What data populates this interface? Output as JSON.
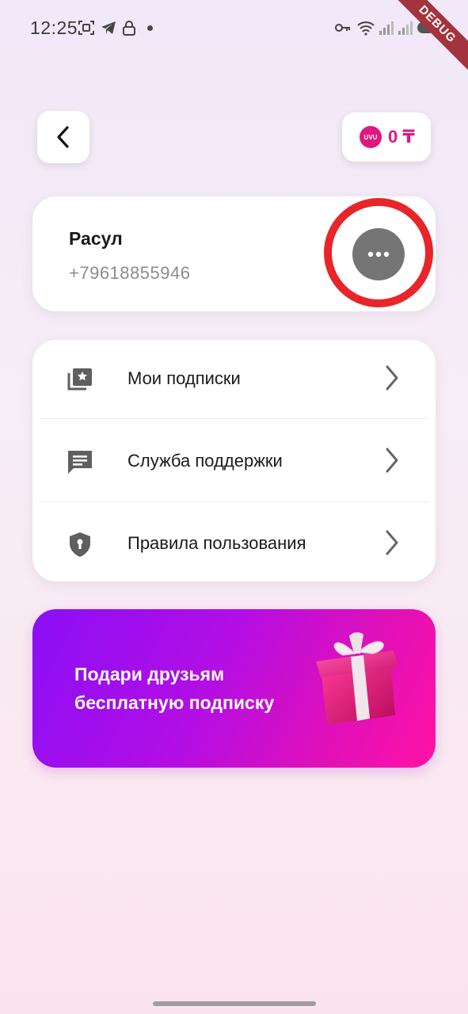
{
  "status_bar": {
    "time": "12:25",
    "debug_label": "DEBUG",
    "icons": [
      "screenshot-icon",
      "telegram-icon",
      "lock-icon",
      "key-icon",
      "wifi-icon",
      "signal-icon",
      "signal-icon",
      "battery-icon"
    ]
  },
  "header": {
    "back_icon": "chevron-left-icon",
    "balance": {
      "coin_label": "UVU",
      "value": "0 ₸"
    }
  },
  "profile": {
    "name": "Расул",
    "phone": "+79618855946",
    "more_icon": "more-horizontal-icon"
  },
  "menu": {
    "items": [
      {
        "label": "Мои подписки",
        "icon": "subscriptions-icon"
      },
      {
        "label": "Служба поддержки",
        "icon": "chat-icon"
      },
      {
        "label": "Правила пользования",
        "icon": "shield-icon"
      }
    ]
  },
  "promo": {
    "text": "Подари друзьям бесплатную подписку",
    "icon": "gift-icon"
  },
  "colors": {
    "accent": "#e0177f",
    "promo_start": "#8a0ff5",
    "promo_end": "#ff12a4",
    "highlight_ring": "#e8252a"
  }
}
